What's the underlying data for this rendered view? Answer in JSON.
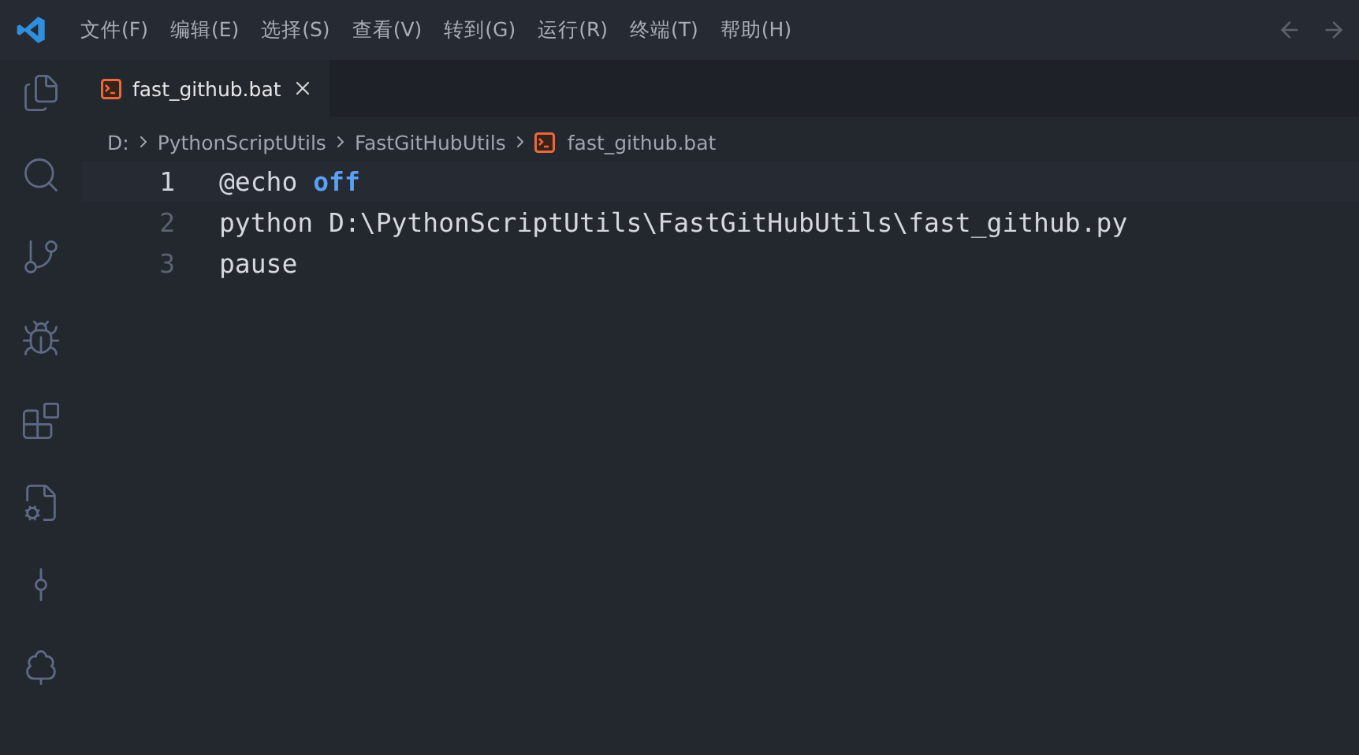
{
  "menu_bar": {
    "items": [
      "文件(F)",
      "编辑(E)",
      "选择(S)",
      "查看(V)",
      "转到(G)",
      "运行(R)",
      "终端(T)",
      "帮助(H)"
    ]
  },
  "activity_bar": {
    "items": [
      {
        "kind": "files",
        "selected": false
      },
      {
        "kind": "search",
        "selected": false
      },
      {
        "kind": "source-control",
        "selected": false
      },
      {
        "kind": "run-debug",
        "selected": false
      },
      {
        "kind": "extensions",
        "selected": false
      },
      {
        "kind": "file-settings",
        "selected": false
      },
      {
        "kind": "git-graph",
        "selected": false
      },
      {
        "kind": "tree",
        "selected": false
      }
    ]
  },
  "tabs": [
    {
      "label": "fast_github.bat",
      "selected": true
    }
  ],
  "breadcrumb": [
    "D:",
    "PythonScriptUtils",
    "FastGitHubUtils",
    "fast_github.bat"
  ],
  "editor": {
    "lines": [
      {
        "number": "1",
        "current": true,
        "tokens": [
          {
            "text": "@echo",
            "kind": "plain"
          },
          {
            "text": "off",
            "kind": "keyword"
          }
        ]
      },
      {
        "number": "2",
        "current": false,
        "tokens": [
          {
            "text": "python D:\\PythonScriptUtils\\FastGitHubUtils\\fast_github.py",
            "kind": "plain"
          }
        ]
      },
      {
        "number": "3",
        "current": false,
        "tokens": [
          {
            "text": "pause",
            "kind": "plain"
          }
        ]
      }
    ]
  }
}
